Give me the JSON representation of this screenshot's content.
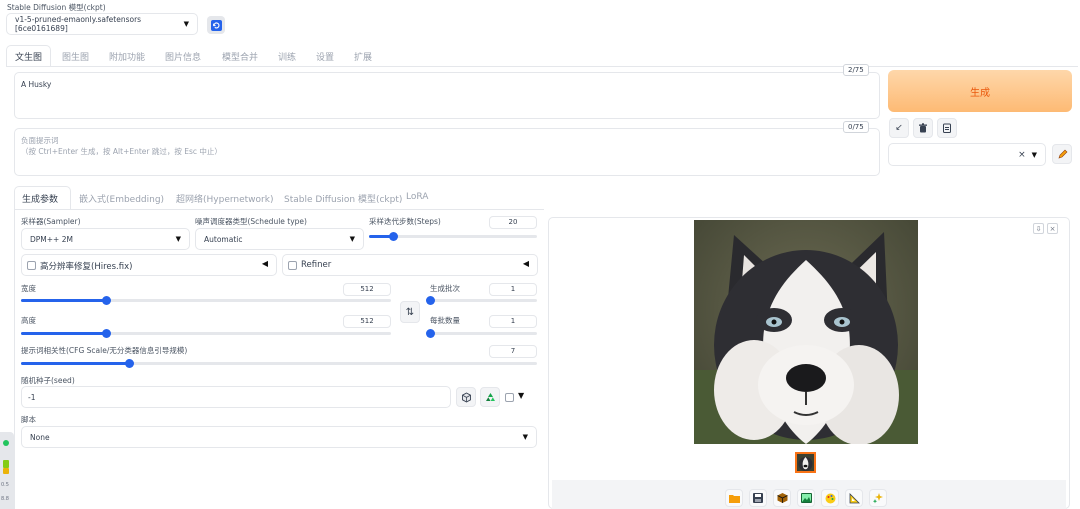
{
  "model": {
    "label": "Stable Diffusion 模型(ckpt)",
    "value": "v1-5-pruned-emaonly.safetensors [6ce0161689]"
  },
  "main_tabs": [
    {
      "label": "文生图"
    },
    {
      "label": "图生图"
    },
    {
      "label": "附加功能"
    },
    {
      "label": "图片信息"
    },
    {
      "label": "模型合并"
    },
    {
      "label": "训练"
    },
    {
      "label": "设置"
    },
    {
      "label": "扩展"
    }
  ],
  "prompt": {
    "value": "A Husky",
    "count": "2/75"
  },
  "negative": {
    "placeholder_line1": "负面提示词",
    "placeholder_line2": "（按 Ctrl+Enter 生成，按 Alt+Enter 跳过，按 Esc 中止）",
    "count": "0/75"
  },
  "generate": {
    "label": "生成"
  },
  "styles": {
    "clear": "×"
  },
  "sub_tabs": [
    {
      "label": "生成参数"
    },
    {
      "label": "嵌入式(Embedding)"
    },
    {
      "label": "超网络(Hypernetwork)"
    },
    {
      "label": "Stable Diffusion 模型(ckpt)"
    },
    {
      "label": "LoRA"
    }
  ],
  "sampler": {
    "label": "采样器(Sampler)",
    "value": "DPM++ 2M"
  },
  "schedule": {
    "label": "噪声调度器类型(Schedule type)",
    "value": "Automatic"
  },
  "steps": {
    "label": "采样迭代步数(Steps)",
    "value": "20",
    "fraction": 0.14
  },
  "hires": {
    "label": "高分辨率修复(Hires.fix)",
    "toggle": "◀"
  },
  "refiner": {
    "label": "Refiner",
    "toggle": "◀"
  },
  "width": {
    "label": "宽度",
    "value": "512",
    "fraction": 0.23
  },
  "height": {
    "label": "高度",
    "value": "512",
    "fraction": 0.23
  },
  "swap": {
    "glyph": "⇅"
  },
  "batch_count": {
    "label": "生成批次",
    "value": "1",
    "fraction": 0.0
  },
  "batch_size": {
    "label": "每批数量",
    "value": "1",
    "fraction": 0.0
  },
  "cfg": {
    "label": "提示词相关性(CFG Scale/无分类器信息引导规模)",
    "value": "7",
    "fraction": 0.21
  },
  "seed": {
    "label": "随机种子(seed)",
    "value": "-1",
    "extra_toggle": "▼"
  },
  "script": {
    "label": "脚本",
    "value": "None"
  },
  "gallery": {
    "image_alt": "A Husky"
  },
  "side_indicators": {
    "text1": "0.5",
    "text2": "8.8"
  },
  "colors": {
    "accent": "#f97316",
    "generate_bg": "#fdba74",
    "slider": "#2563eb"
  }
}
